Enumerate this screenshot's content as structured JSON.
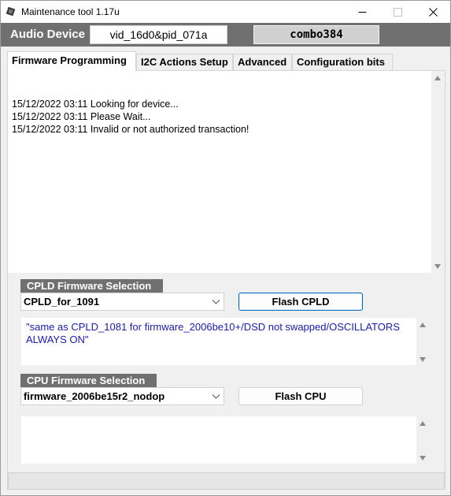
{
  "window": {
    "title": "Maintenance tool 1.17u"
  },
  "device_bar": {
    "label": "Audio Device",
    "device_id": "vid_16d0&pid_071a",
    "device_name": "combo384"
  },
  "tabs": [
    {
      "label": "Firmware Programming",
      "active": true
    },
    {
      "label": "I2C Actions Setup",
      "active": false
    },
    {
      "label": "Advanced",
      "active": false
    },
    {
      "label": "Configuration bits",
      "active": false
    }
  ],
  "log": {
    "lines": [
      "15/12/2022 03:11 Looking for device...",
      "15/12/2022 03:11 Please Wait...",
      "15/12/2022 03:11 Invalid or not authorized transaction!"
    ]
  },
  "cpld": {
    "group_label": "CPLD Firmware Selection",
    "selected": "CPLD_for_1091",
    "button_label": "Flash CPLD",
    "description": "\"same as CPLD_1081 for firmware_2006be10+/DSD not swapped/OSCILLATORS ALWAYS ON\""
  },
  "cpu": {
    "group_label": "CPU Firmware Selection",
    "selected": "firmware_2006be15r2_nodop",
    "button_label": "Flash CPU",
    "description": ""
  },
  "icons": {
    "app": "chip-icon",
    "minimize": "minimize-icon",
    "maximize": "maximize-icon",
    "close": "close-icon",
    "dropdown": "chevron-down-icon"
  },
  "colors": {
    "bar_gray": "#707070",
    "description_text": "#1a1ab4",
    "focus_border": "#0067c0"
  }
}
